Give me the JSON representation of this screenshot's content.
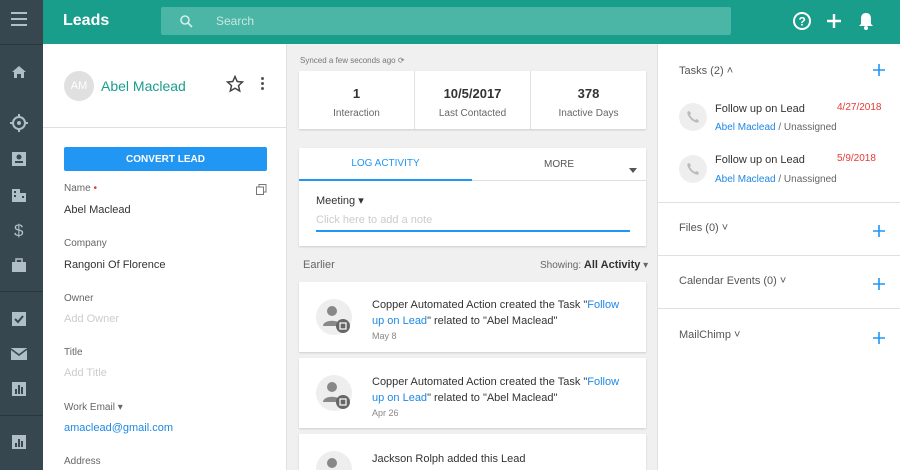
{
  "app": {
    "title": "Leads"
  },
  "search": {
    "placeholder": "Search"
  },
  "lead": {
    "initials": "AM",
    "name": "Abel Maclead",
    "convert_label": "CONVERT LEAD"
  },
  "fields": {
    "name_label": "Name",
    "name_required": "•",
    "name_value": "Abel Maclead",
    "company_label": "Company",
    "company_value": "Rangoni Of Florence",
    "owner_label": "Owner",
    "owner_placeholder": "Add Owner",
    "title_label": "Title",
    "title_placeholder": "Add Title",
    "work_email_label": "Work Email",
    "work_email_value": "amaclead@gmail.com",
    "address_label": "Address"
  },
  "sync": {
    "text": "Synced a few seconds ago"
  },
  "stats": [
    {
      "value": "1",
      "label": "Interaction"
    },
    {
      "value": "10/5/2017",
      "label": "Last Contacted"
    },
    {
      "value": "378",
      "label": "Inactive Days"
    }
  ],
  "log": {
    "tab_log": "LOG ACTIVITY",
    "tab_more": "MORE",
    "activity_type": "Meeting",
    "note_placeholder": "Click here to add a note"
  },
  "feed": {
    "earlier_label": "Earlier",
    "showing_label": "Showing:",
    "showing_value": "All Activity",
    "items": [
      {
        "prefix": "Copper Automated Action created the Task \"",
        "link": "Follow up on Lead",
        "suffix": "\" related to \"Abel Maclead\"",
        "date": "May 8"
      },
      {
        "prefix": "Copper Automated Action created the Task \"",
        "link": "Follow up on Lead",
        "suffix": "\" related to \"Abel Maclead\"",
        "date": "Apr 26"
      },
      {
        "prefix": "Jackson Rolph added this Lead",
        "link": "",
        "suffix": "",
        "date": ""
      }
    ]
  },
  "sidebar": {
    "tasks_label": "Tasks (2)",
    "files_label": "Files (0)",
    "calendar_label": "Calendar Events (0)",
    "mailchimp_label": "MailChimp",
    "tasks": [
      {
        "title": "Follow up on Lead",
        "date": "4/27/2018",
        "person": "Abel Maclead",
        "assignee": " / Unassigned"
      },
      {
        "title": "Follow up on Lead",
        "date": "5/9/2018",
        "person": "Abel Maclead",
        "assignee": " / Unassigned"
      }
    ]
  },
  "colors": {
    "brand": "#1a9e8c",
    "accent": "#2196f3",
    "nav": "#37474f",
    "due": "#e53935"
  },
  "icons": {
    "nav": [
      "menu-icon",
      "home-icon",
      "target-icon",
      "contact-card-icon",
      "building-icon",
      "dollar-icon",
      "briefcase-icon",
      "checkbox-icon",
      "mail-icon",
      "bar-chart-icon",
      "report-icon"
    ],
    "top": [
      "help-icon",
      "plus-icon",
      "bell-icon"
    ]
  }
}
